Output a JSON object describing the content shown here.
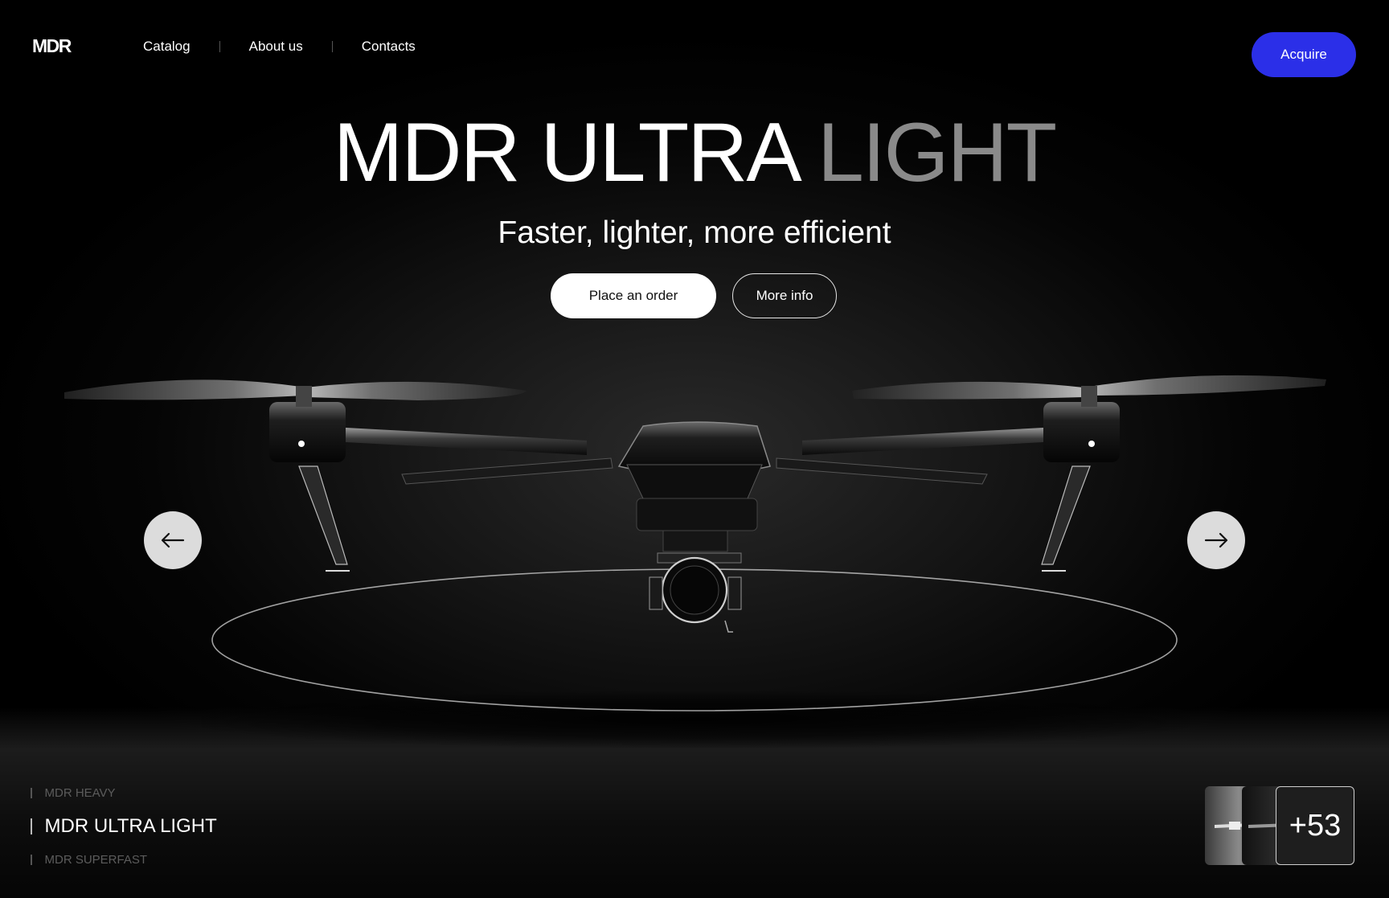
{
  "brand": {
    "logo": "MDR"
  },
  "nav": {
    "items": [
      {
        "label": "Catalog"
      },
      {
        "label": "About us"
      },
      {
        "label": "Contacts"
      }
    ],
    "acquire_label": "Acquire"
  },
  "hero": {
    "title_main": "MDR ULTRA",
    "title_accent": "LIGHT",
    "subtitle": "Faster, lighter, more efficient",
    "primary_cta": "Place an order",
    "secondary_cta": "More info"
  },
  "carousel": {
    "prev_icon": "arrow-left-icon",
    "next_icon": "arrow-right-icon"
  },
  "models": [
    {
      "label": "MDR HEAVY"
    },
    {
      "label": "MDR ULTRA LIGHT"
    },
    {
      "label": "MDR SUPERFAST"
    }
  ],
  "gallery": {
    "more_count": "+53"
  },
  "colors": {
    "accent": "#2b2fe8",
    "background": "#000000",
    "title_dim": "#8a8a8a"
  }
}
